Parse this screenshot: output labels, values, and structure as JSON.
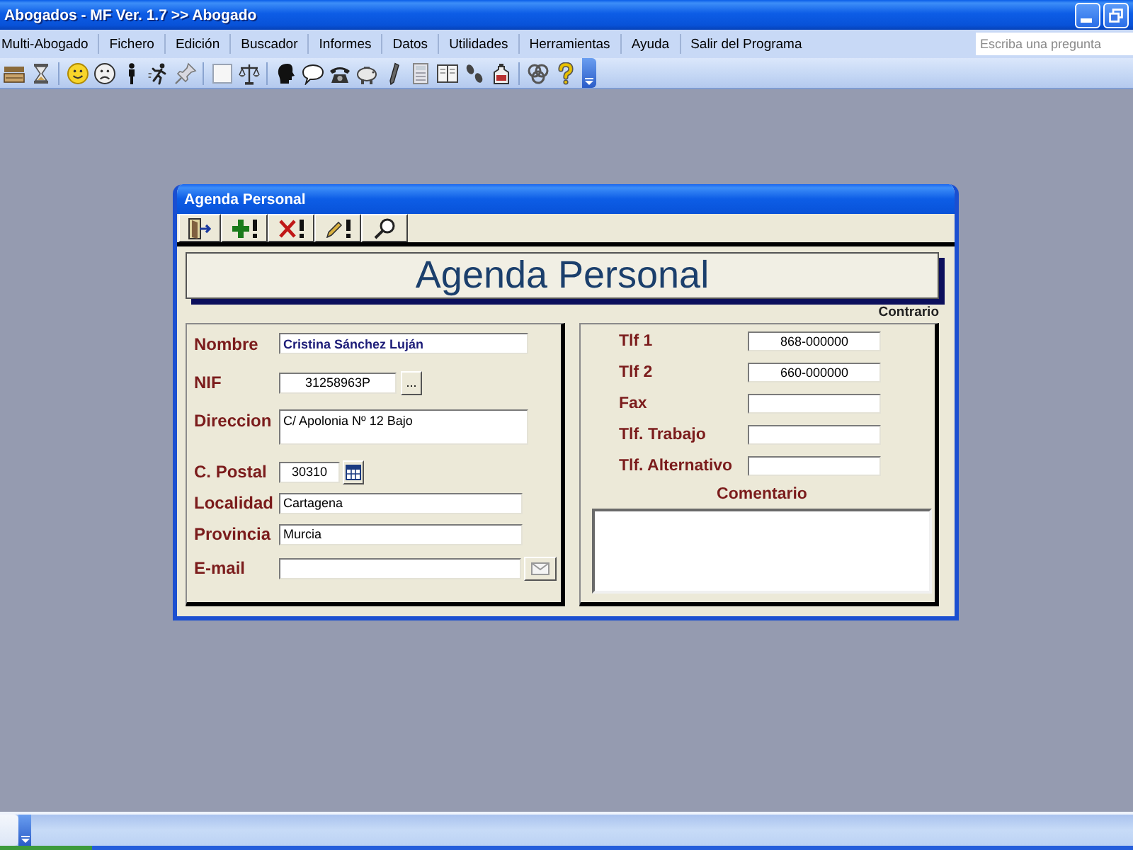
{
  "window": {
    "title": "Abogados - MF Ver. 1.7 >> Abogado"
  },
  "menu_bar": {
    "items": [
      "Multi-Abogado",
      "Fichero",
      "Edición",
      "Buscador",
      "Informes",
      "Datos",
      "Utilidades",
      "Herramientas",
      "Ayuda",
      "Salir del Programa"
    ],
    "help_search": {
      "placeholder": "Escriba una pregunta"
    }
  },
  "dialog": {
    "title": "Agenda Personal",
    "banner_title": "Agenda Personal",
    "section_label": "Contrario",
    "left_fields": [
      {
        "kind": "name",
        "label": "Nombre",
        "value": "Cristina Sánchez Luján"
      },
      {
        "kind": "lookup",
        "label": "NIF",
        "value": "31258963P",
        "button": "..."
      },
      {
        "kind": "multiline",
        "label": "Direccion",
        "value": "C/ Apolonia Nº 12 Bajo"
      },
      {
        "kind": "picker",
        "label": "C. Postal",
        "value": "30310"
      },
      {
        "kind": "text",
        "label": "Localidad",
        "value": "Cartagena"
      },
      {
        "kind": "text",
        "label": "Provincia",
        "value": "Murcia"
      },
      {
        "kind": "mail",
        "label": "E-mail"
      }
    ],
    "right_fields": [
      {
        "label": "Tlf 1",
        "value": "868-000000"
      },
      {
        "label": "Tlf 2",
        "value": "660-000000"
      },
      {
        "label": "Fax"
      },
      {
        "label": "Tlf. Trabajo"
      },
      {
        "label": "Tlf. Alternativo"
      }
    ],
    "comment": {
      "label": "Comentario"
    }
  }
}
